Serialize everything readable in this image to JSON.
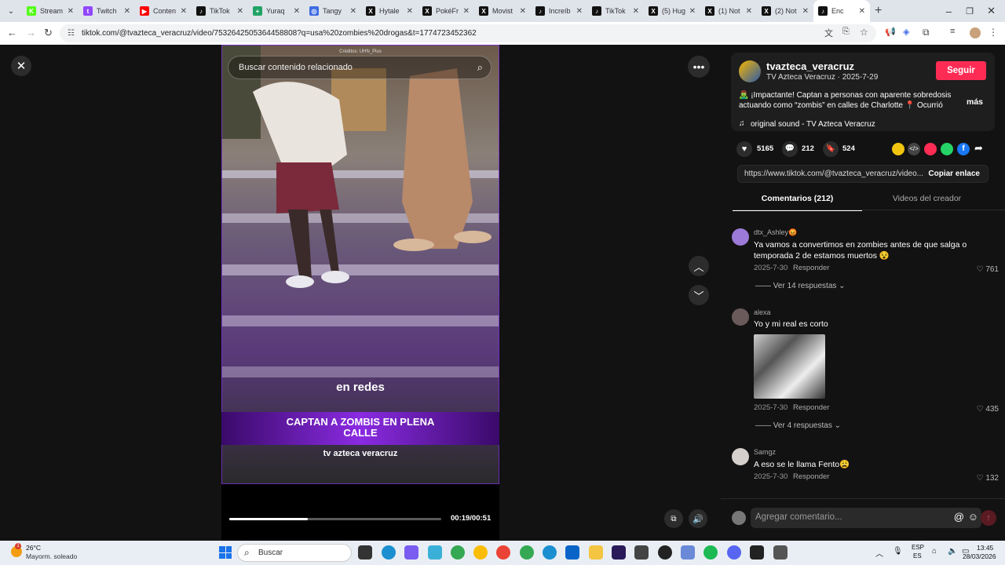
{
  "tabs": [
    {
      "label": "Stream",
      "color": "#53fc18",
      "glyph": "K"
    },
    {
      "label": "Twitch",
      "color": "#9146ff",
      "glyph": "t"
    },
    {
      "label": "Conten",
      "color": "#ff0000",
      "glyph": "▶"
    },
    {
      "label": "TikTok",
      "color": "#111111",
      "glyph": "♪"
    },
    {
      "label": "Yuraq",
      "color": "#21a366",
      "glyph": "+"
    },
    {
      "label": "Tangy",
      "color": "#3d6be3",
      "glyph": "◎"
    },
    {
      "label": "Hytale",
      "color": "#111111",
      "glyph": "X"
    },
    {
      "label": "PokéFr",
      "color": "#111111",
      "glyph": "X"
    },
    {
      "label": "Movist",
      "color": "#111111",
      "glyph": "X"
    },
    {
      "label": "Increíb",
      "color": "#111111",
      "glyph": "♪"
    },
    {
      "label": "TikTok",
      "color": "#111111",
      "glyph": "♪"
    },
    {
      "label": "(5) Hug",
      "color": "#111111",
      "glyph": "X"
    },
    {
      "label": "(1) Not",
      "color": "#111111",
      "glyph": "X"
    },
    {
      "label": "(2) Not",
      "color": "#111111",
      "glyph": "X"
    },
    {
      "label": "Enc",
      "color": "#111111",
      "glyph": "♪"
    }
  ],
  "url": "tiktok.com/@tvazteca_veracruz/video/7532642505364458808?q=usa%20zombies%20drogas&t=1774723452362",
  "video": {
    "search_placeholder": "Buscar contenido relacionado",
    "credits": "Créditos: UHN_Plus",
    "caption_small": "en redes",
    "headline": "CAPTAN A ZOMBIS EN PLENA CALLE",
    "brand": "tv azteca veracruz",
    "time": "00:19/00:51",
    "progress": 0.37
  },
  "author": {
    "username": "tvazteca_veracruz",
    "subtitle": "TV Azteca Veracruz · 2025-7-29",
    "follow": "Seguir",
    "description": "🧟‍♂️ ¡Impactante! Captan a personas con aparente sobredosis actuando como “zombis” en calles de Charlotte 📍 Ocurrió frent...",
    "more": "más",
    "sound": "original sound - TV Azteca Veracruz"
  },
  "stats": {
    "likes": "5165",
    "comments": "212",
    "saves": "524"
  },
  "link": {
    "url": "https://www.tiktok.com/@tvazteca_veracruz/video...",
    "copy": "Copiar enlace"
  },
  "tabs_panel": {
    "comments": "Comentarios (212)",
    "creator": "Videos del creador"
  },
  "comments": [
    {
      "user": "dtx_Ashley😡",
      "text": "Ya vamos a convertimos en zombies antes de que salga o temporada 2 de estamos muertos 😵",
      "date": "2025-7-30",
      "reply": "Responder",
      "likes": "761",
      "replies": "Ver 14 respuestas"
    },
    {
      "user": "alexa",
      "text": "Yo y mi real es corto",
      "date": "2025-7-30",
      "reply": "Responder",
      "likes": "435",
      "replies": "Ver 4 respuestas"
    },
    {
      "user": "Samgz",
      "text": "A eso se le llama Fento😩",
      "date": "2025-7-30",
      "reply": "Responder",
      "likes": "132"
    }
  ],
  "comment_input": {
    "placeholder": "Agregar comentario..."
  },
  "taskbar": {
    "temp": "26°C",
    "weather": "Mayorm. soleado",
    "search": "Buscar",
    "lang1": "ESP",
    "lang2": "ES",
    "time": "13:45",
    "date": "28/03/2026",
    "badge": "1"
  }
}
